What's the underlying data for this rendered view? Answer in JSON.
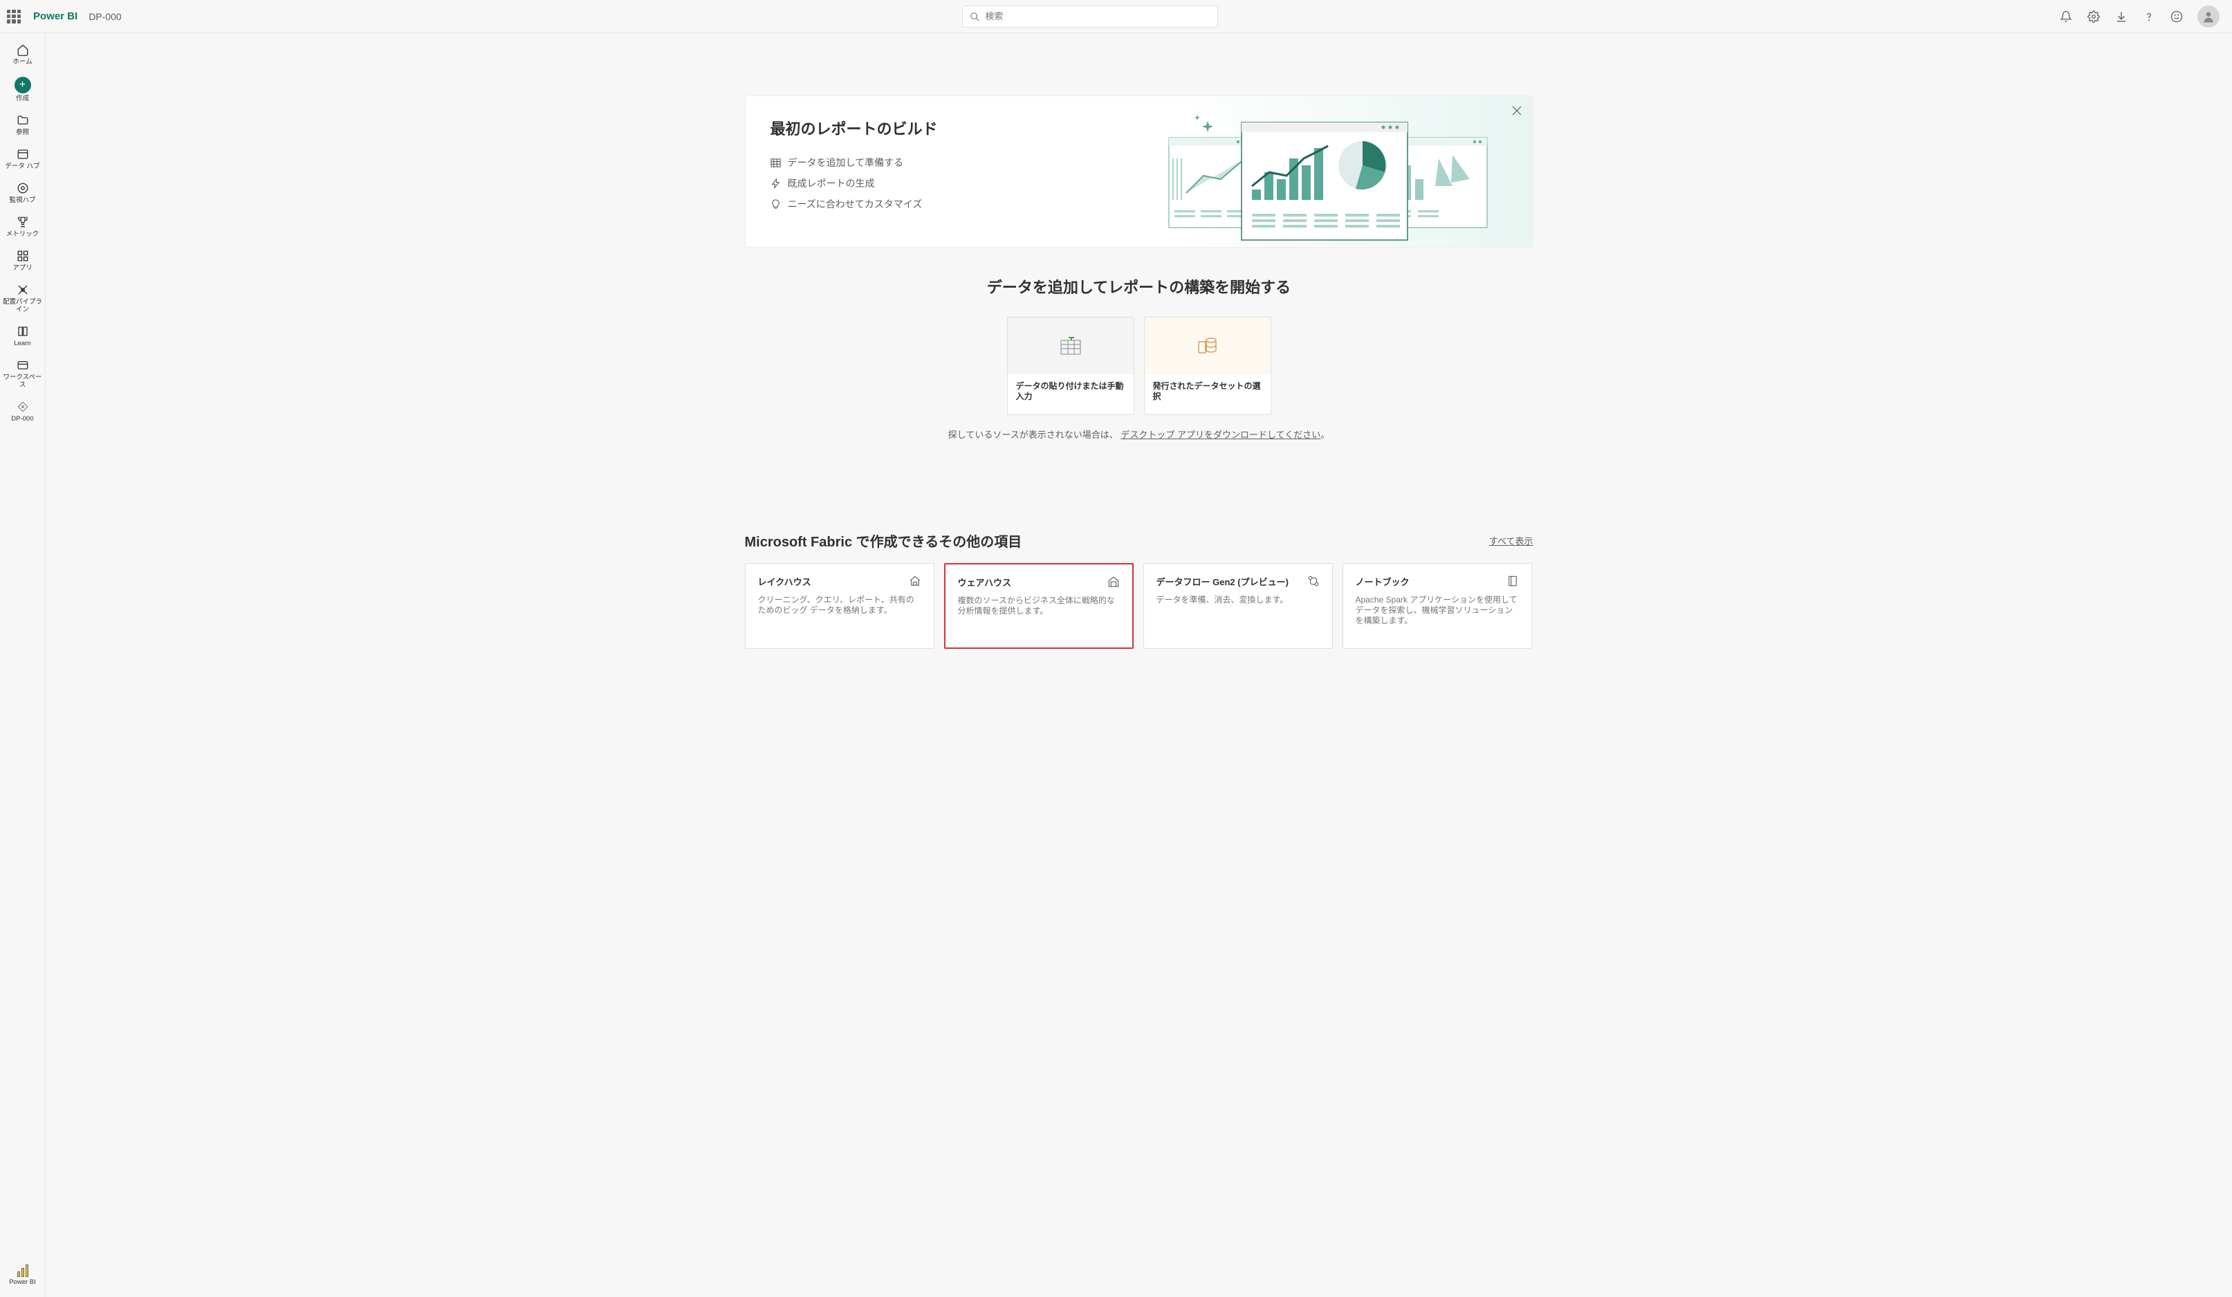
{
  "header": {
    "brand": "Power BI",
    "breadcrumb": "DP-000",
    "search_placeholder": "検索"
  },
  "nav": {
    "home": "ホーム",
    "create": "作成",
    "browse": "参照",
    "data_hub": "データ ハブ",
    "monitoring_hub": "監視ハブ",
    "metrics": "メトリック",
    "apps": "アプリ",
    "pipelines": "配置パイプライン",
    "learn": "Learn",
    "workspaces": "ワークスペース",
    "current_ws": "DP-000",
    "powerbi_label": "Power BI"
  },
  "hero": {
    "title": "最初のレポートのビルド",
    "step1": "データを追加して準備する",
    "step2": "既成レポートの生成",
    "step3": "ニーズに合わせてカスタマイズ"
  },
  "add_data_title": "データを追加してレポートの構築を開始する",
  "sources": {
    "paste": "データの貼り付けまたは手動入力",
    "dataset": "発行されたデータセットの選択"
  },
  "download_hint": {
    "prefix": "探しているソースが表示されない場合は、",
    "link": "デスクトップ アプリをダウンロードしてください",
    "suffix": "。"
  },
  "fabric": {
    "title": "Microsoft Fabric で作成できるその他の項目",
    "show_all": "すべて表示",
    "cards": {
      "lakehouse": {
        "title": "レイクハウス",
        "desc": "クリーニング、クエリ、レポート、共有のためのビッグ データを格納します。"
      },
      "warehouse": {
        "title": "ウェアハウス",
        "desc": "複数のソースからビジネス全体に戦略的な分析情報を提供します。"
      },
      "dataflow": {
        "title": "データフロー Gen2 (プレビュー)",
        "desc": "データを準備、消去、変換します。"
      },
      "notebook": {
        "title": "ノートブック",
        "desc": "Apache Spark アプリケーションを使用してデータを探索し、機械学習ソリューションを構築します。"
      }
    }
  }
}
